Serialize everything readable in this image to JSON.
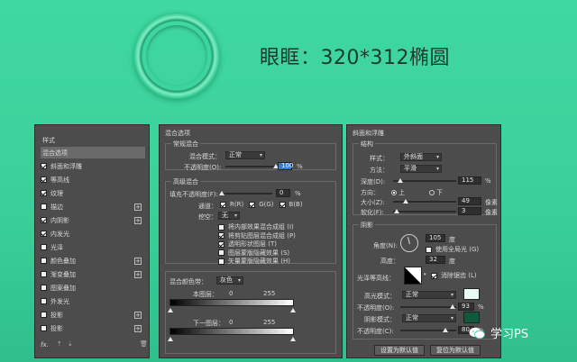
{
  "heading": "眼眶：320*312椭圆",
  "styles_panel": {
    "title": "样式",
    "items": [
      {
        "label": "混合选项",
        "checkbox": false,
        "checked": false,
        "plus": false,
        "selected": true
      },
      {
        "label": "斜面和浮雕",
        "checkbox": true,
        "checked": true,
        "plus": false,
        "selected": false
      },
      {
        "label": "等高线",
        "checkbox": true,
        "checked": true,
        "plus": false,
        "selected": false
      },
      {
        "label": "纹理",
        "checkbox": true,
        "checked": true,
        "plus": false,
        "selected": false
      },
      {
        "label": "描边",
        "checkbox": true,
        "checked": false,
        "plus": true,
        "selected": false
      },
      {
        "label": "内阴影",
        "checkbox": true,
        "checked": true,
        "plus": true,
        "selected": false
      },
      {
        "label": "内发光",
        "checkbox": true,
        "checked": true,
        "plus": false,
        "selected": false
      },
      {
        "label": "光泽",
        "checkbox": true,
        "checked": false,
        "plus": false,
        "selected": false
      },
      {
        "label": "颜色叠加",
        "checkbox": true,
        "checked": false,
        "plus": true,
        "selected": false
      },
      {
        "label": "渐变叠加",
        "checkbox": true,
        "checked": false,
        "plus": true,
        "selected": false
      },
      {
        "label": "图案叠加",
        "checkbox": true,
        "checked": false,
        "plus": false,
        "selected": false
      },
      {
        "label": "外发光",
        "checkbox": true,
        "checked": false,
        "plus": false,
        "selected": false
      },
      {
        "label": "投影",
        "checkbox": true,
        "checked": false,
        "plus": true,
        "selected": false
      },
      {
        "label": "投影",
        "checkbox": true,
        "checked": false,
        "plus": true,
        "selected": false
      }
    ],
    "footer_fx": "fx.",
    "footer_icons": [
      "arrow-up-icon",
      "arrow-down-icon",
      "trash-icon"
    ]
  },
  "blend_panel": {
    "title": "混合选项",
    "general": {
      "title": "常规混合",
      "mode_label": "混合模式：",
      "mode_value": "正常",
      "opacity_label": "不透明度(O):",
      "opacity_value": "100",
      "opacity_unit": "%",
      "opacity_fraction": 1.0
    },
    "advanced": {
      "title": "高级混合",
      "fill_label": "填充不透明度(F):",
      "fill_value": "0",
      "fill_unit": "%",
      "fill_fraction": 0.0,
      "channels_label": "通道：",
      "channels": [
        "R(R)",
        "G(G)",
        "B(B)"
      ],
      "knockout_label": "挖空：",
      "knockout_value": "无",
      "options": [
        {
          "label": "将内部效果混合成组 (I)",
          "checked": false
        },
        {
          "label": "将剪贴图层混合成组 (P)",
          "checked": true
        },
        {
          "label": "透明形状图层 (T)",
          "checked": true
        },
        {
          "label": "图层蒙版隐藏效果 (S)",
          "checked": false
        },
        {
          "label": "矢量蒙版隐藏效果 (H)",
          "checked": false
        }
      ]
    },
    "blend_if": {
      "label": "混合颜色带：",
      "value": "灰色",
      "this_layer": "本图层：",
      "lower_layer": "下一图层：",
      "min": "0",
      "max": "255"
    }
  },
  "bevel_panel": {
    "title": "斜面和浮雕",
    "structure": {
      "title": "结构",
      "style_label": "样式：",
      "style_value": "外斜面",
      "technique_label": "方法：",
      "technique_value": "平滑",
      "depth_label": "深度(D):",
      "depth_value": "115",
      "depth_unit": "%",
      "depth_fraction": 0.12,
      "direction_label": "方向：",
      "direction_up": "上",
      "direction_down": "下",
      "size_label": "大小(Z):",
      "size_value": "49",
      "size_unit": "像素",
      "size_fraction": 0.2,
      "soften_label": "软化(F):",
      "soften_value": "3",
      "soften_unit": "像素",
      "soften_fraction": 0.05
    },
    "shading": {
      "title": "阴影",
      "angle_label": "角度(N):",
      "angle_value": "105",
      "angle_unit": "度",
      "global_light_label": "使用全局光 (G)",
      "altitude_label": "高度：",
      "altitude_value": "32",
      "altitude_unit": "度",
      "gloss_label": "光泽等高线：",
      "antialias_label": "消除锯齿 (L)",
      "highlight_mode_label": "高光模式：",
      "highlight_mode_value": "正常",
      "highlight_color": "#e9fbf3",
      "highlight_opacity_label": "不透明度(O):",
      "highlight_opacity_value": "93",
      "highlight_opacity_fraction": 0.93,
      "shadow_mode_label": "阴影模式：",
      "shadow_mode_value": "正常",
      "shadow_color": "#0f5a3a",
      "shadow_opacity_label": "不透明度(C):",
      "shadow_opacity_value": "80",
      "shadow_opacity_fraction": 0.8,
      "unit_pct": "%"
    },
    "btn_default": "设置为默认值",
    "btn_reset": "复位为默认值"
  },
  "watermark": "学习PS"
}
